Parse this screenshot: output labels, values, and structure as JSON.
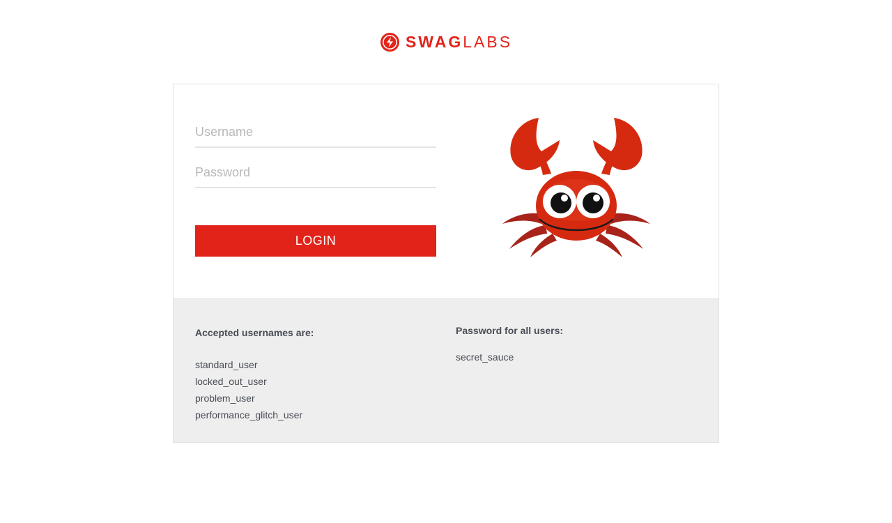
{
  "brand": {
    "name_bold": "SWAG",
    "name_light": "LABS",
    "logo_icon": "swag-labs-bolt-icon",
    "color": "#e2231a"
  },
  "login": {
    "username_placeholder": "Username",
    "username_value": "",
    "password_placeholder": "Password",
    "password_value": "",
    "button_label": "LOGIN",
    "button_color": "#e2231a",
    "mascot_icon": "crab-mascot"
  },
  "credentials": {
    "usernames_heading": "Accepted usernames are:",
    "usernames": [
      "standard_user",
      "locked_out_user",
      "problem_user",
      "performance_glitch_user"
    ],
    "password_heading": "Password for all users:",
    "password": "secret_sauce",
    "background": "#eeeeee"
  }
}
